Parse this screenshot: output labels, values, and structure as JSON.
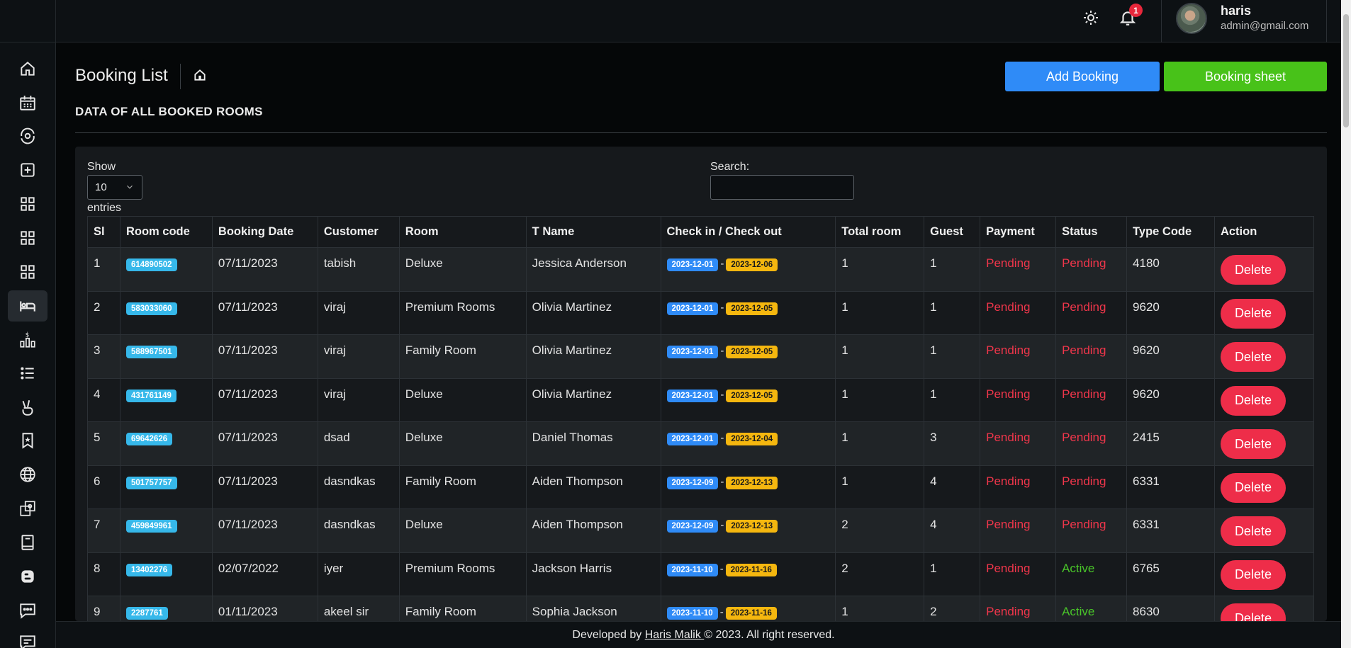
{
  "topbar": {
    "notif_count": "1",
    "user_name": "haris",
    "user_email": "admin@gmail.com"
  },
  "sidebar": {
    "items": [
      {
        "icon": "home-icon",
        "active": false
      },
      {
        "icon": "calendar-icon",
        "active": false
      },
      {
        "icon": "gear-eye-icon",
        "active": false
      },
      {
        "icon": "add-square-icon",
        "active": false
      },
      {
        "icon": "grid-icon",
        "active": false
      },
      {
        "icon": "grid-icon",
        "active": false
      },
      {
        "icon": "grid-icon",
        "active": false
      },
      {
        "icon": "bed-icon",
        "active": true
      },
      {
        "icon": "chart-dollar-icon",
        "active": false
      },
      {
        "icon": "list-icon",
        "active": false
      },
      {
        "icon": "peace-hand-icon",
        "active": false
      },
      {
        "icon": "bookmark-star-icon",
        "active": false
      },
      {
        "icon": "globe-icon",
        "active": false
      },
      {
        "icon": "settings-window-icon",
        "active": false
      },
      {
        "icon": "book-icon",
        "active": false
      },
      {
        "icon": "blogger-icon",
        "active": false
      },
      {
        "icon": "sms-icon",
        "active": false
      },
      {
        "icon": "message-icon",
        "active": false
      }
    ]
  },
  "header": {
    "title": "Booking List",
    "add_button": "Add Booking",
    "sheet_button": "Booking sheet",
    "section_title": "DATA OF ALL BOOKED ROOMS"
  },
  "controls": {
    "show_label": "Show",
    "show_value": "10",
    "entries_label": "entries",
    "search_label": "Search:"
  },
  "table": {
    "columns": [
      "Sl",
      "Room code",
      "Booking Date",
      "Customer",
      "Room",
      "T Name",
      "Check in / Check out",
      "Total room",
      "Guest",
      "Payment",
      "Status",
      "Type Code",
      "Action"
    ],
    "delete_label": "Delete",
    "rows": [
      {
        "sl": "1",
        "code": "614890502",
        "date": "07/11/2023",
        "customer": "tabish",
        "room": "Deluxe",
        "tname": "Jessica Anderson",
        "checkin": "2023-12-01",
        "checkout": "2023-12-06",
        "total": "1",
        "guest": "1",
        "payment": "Pending",
        "status": "Pending",
        "type": "4180"
      },
      {
        "sl": "2",
        "code": "583033060",
        "date": "07/11/2023",
        "customer": "viraj",
        "room": "Premium Rooms",
        "tname": "Olivia Martinez",
        "checkin": "2023-12-01",
        "checkout": "2023-12-05",
        "total": "1",
        "guest": "1",
        "payment": "Pending",
        "status": "Pending",
        "type": "9620"
      },
      {
        "sl": "3",
        "code": "588967501",
        "date": "07/11/2023",
        "customer": "viraj",
        "room": "Family Room",
        "tname": "Olivia Martinez",
        "checkin": "2023-12-01",
        "checkout": "2023-12-05",
        "total": "1",
        "guest": "1",
        "payment": "Pending",
        "status": "Pending",
        "type": "9620"
      },
      {
        "sl": "4",
        "code": "431761149",
        "date": "07/11/2023",
        "customer": "viraj",
        "room": "Deluxe",
        "tname": "Olivia Martinez",
        "checkin": "2023-12-01",
        "checkout": "2023-12-05",
        "total": "1",
        "guest": "1",
        "payment": "Pending",
        "status": "Pending",
        "type": "9620"
      },
      {
        "sl": "5",
        "code": "69642626",
        "date": "07/11/2023",
        "customer": "dsad",
        "room": "Deluxe",
        "tname": "Daniel Thomas",
        "checkin": "2023-12-01",
        "checkout": "2023-12-04",
        "total": "1",
        "guest": "3",
        "payment": "Pending",
        "status": "Pending",
        "type": "2415"
      },
      {
        "sl": "6",
        "code": "501757757",
        "date": "07/11/2023",
        "customer": "dasndkas",
        "room": "Family Room",
        "tname": "Aiden Thompson",
        "checkin": "2023-12-09",
        "checkout": "2023-12-13",
        "total": "1",
        "guest": "4",
        "payment": "Pending",
        "status": "Pending",
        "type": "6331"
      },
      {
        "sl": "7",
        "code": "459849961",
        "date": "07/11/2023",
        "customer": "dasndkas",
        "room": "Deluxe",
        "tname": "Aiden Thompson",
        "checkin": "2023-12-09",
        "checkout": "2023-12-13",
        "total": "2",
        "guest": "4",
        "payment": "Pending",
        "status": "Pending",
        "type": "6331"
      },
      {
        "sl": "8",
        "code": "13402276",
        "date": "02/07/2022",
        "customer": "iyer",
        "room": "Premium Rooms",
        "tname": "Jackson Harris",
        "checkin": "2023-11-10",
        "checkout": "2023-11-16",
        "total": "2",
        "guest": "1",
        "payment": "Pending",
        "status": "Active",
        "type": "6765"
      },
      {
        "sl": "9",
        "code": "2287761",
        "date": "01/11/2023",
        "customer": "akeel sir",
        "room": "Family Room",
        "tname": "Sophia Jackson",
        "checkin": "2023-11-10",
        "checkout": "2023-11-16",
        "total": "1",
        "guest": "2",
        "payment": "Pending",
        "status": "Active",
        "type": "8630"
      }
    ]
  },
  "footer": {
    "prefix": "Developed by ",
    "author": "Haris Malik ",
    "suffix": "© 2023. All right reserved."
  }
}
